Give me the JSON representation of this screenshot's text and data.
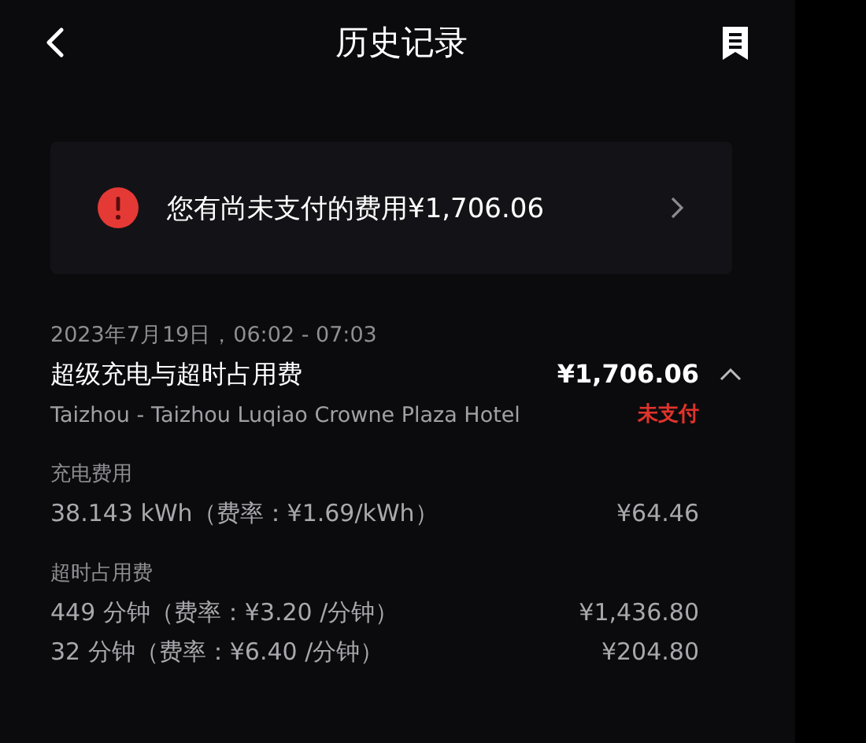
{
  "header": {
    "title": "历史记录"
  },
  "notice": {
    "text": "您有尚未支付的费用¥1,706.06"
  },
  "record": {
    "date": "2023年7月19日，06:02 - 07:03",
    "title": "超级充电与超时占用费",
    "amount": "¥1,706.06",
    "expanded": true,
    "location": "Taizhou - Taizhou Luqiao Crowne Plaza Hotel",
    "status": {
      "kind": "unpaid",
      "text": "未支付"
    },
    "sections": [
      {
        "label": "充电费用",
        "lines": [
          {
            "detail": "38.143 kWh（费率：¥1.69/kWh）",
            "amount": "¥64.46"
          }
        ]
      },
      {
        "label": "超时占用费",
        "lines": [
          {
            "detail": "449 分钟（费率：¥3.20 /分钟）",
            "amount": "¥1,436.80"
          },
          {
            "detail": "32 分钟（费率：¥6.40 /分钟）",
            "amount": "¥204.80"
          }
        ]
      }
    ]
  }
}
